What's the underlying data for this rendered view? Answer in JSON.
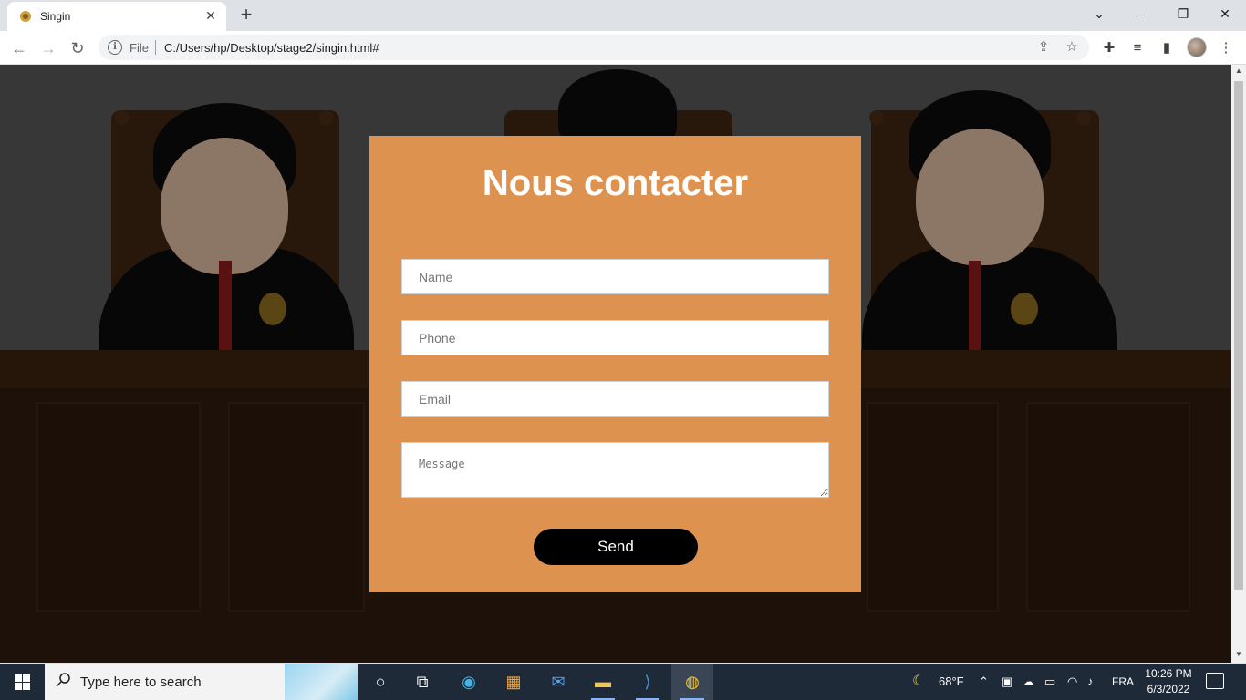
{
  "browser": {
    "tab_title": "Singin",
    "url_scheme_label": "File",
    "url": "C:/Users/hp/Desktop/stage2/singin.html#",
    "new_tab_symbol": "+",
    "tab_close_symbol": "✕"
  },
  "page": {
    "title": "Nous contacter",
    "fields": {
      "name_placeholder": "Name",
      "phone_placeholder": "Phone",
      "email_placeholder": "Email",
      "message_placeholder": "Message"
    },
    "send_label": "Send",
    "colors": {
      "card": "#de924f",
      "button": "#000000",
      "title": "#ffffff"
    }
  },
  "taskbar": {
    "search_placeholder": "Type here to search",
    "weather": "68°F",
    "language": "FRA",
    "time": "10:26 PM",
    "date": "6/3/2022",
    "pinned_apps": [
      "cortana-icon",
      "task-view-icon",
      "edge-icon",
      "store-icon",
      "mail-icon",
      "file-explorer-icon",
      "vscode-icon",
      "chrome-icon"
    ]
  }
}
